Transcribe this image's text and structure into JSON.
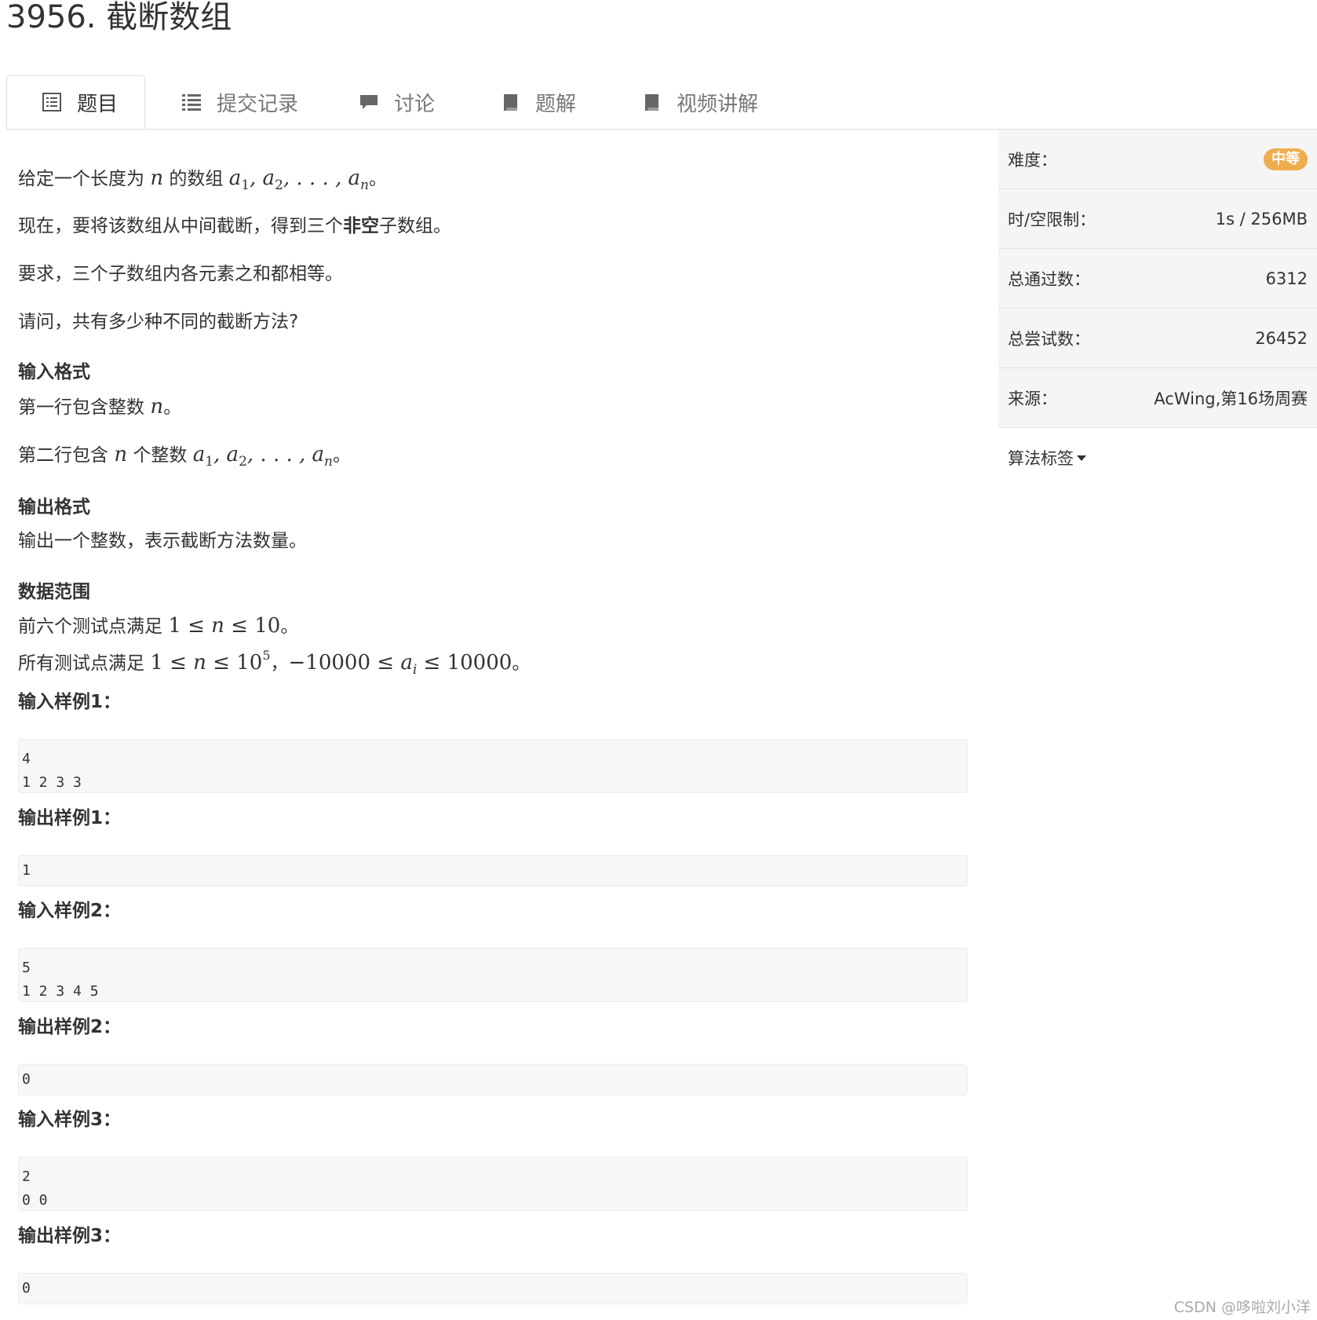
{
  "title": "3956. 截断数组",
  "tabs": [
    {
      "label": "题目",
      "icon": "list-alt-icon"
    },
    {
      "label": "提交记录",
      "icon": "list-icon"
    },
    {
      "label": "讨论",
      "icon": "comment-icon"
    },
    {
      "label": "题解",
      "icon": "book-icon"
    },
    {
      "label": "视频讲解",
      "icon": "book-icon"
    }
  ],
  "problem": {
    "p1": {
      "a": "给定一个长度为 ",
      "n": "n",
      "b": " 的数组 ",
      "c": "。"
    },
    "p2": {
      "a": "现在，要将该数组从中间截断，得到三个",
      "bold": "非空",
      "b": "子数组。"
    },
    "p3": "要求，三个子数组内各元素之和都相等。",
    "p4": "请问，共有多少种不同的截断方法?",
    "input_heading": "输入格式",
    "input_line1": {
      "a": "第一行包含整数 ",
      "b": "。"
    },
    "input_line2": {
      "a": "第二行包含 ",
      "b": " 个整数 ",
      "c": "。"
    },
    "output_heading": "输出格式",
    "output_line": "输出一个整数，表示截断方法数量。",
    "range_heading": "数据范围",
    "range_line1": {
      "a": "前六个测试点满足 ",
      "b": "。"
    },
    "range_line2": {
      "a": "所有测试点满足 ",
      "b": "，",
      "c": "。"
    }
  },
  "samples": [
    {
      "label": "输入样例1：",
      "content": "4\n1 2 3 3"
    },
    {
      "label": "输出样例1：",
      "content": "1"
    },
    {
      "label": "输入样例2：",
      "content": "5\n1 2 3 4 5"
    },
    {
      "label": "输出样例2：",
      "content": "0"
    },
    {
      "label": "输入样例3：",
      "content": "2\n0 0"
    },
    {
      "label": "输出样例3：",
      "content": "0"
    }
  ],
  "sidebar": {
    "difficulty_label": "难度：",
    "difficulty_value": "中等",
    "limit_label": "时/空限制：",
    "limit_value": "1s / 256MB",
    "passed_label": "总通过数：",
    "passed_value": "6312",
    "attempts_label": "总尝试数：",
    "attempts_value": "26452",
    "source_label": "来源：",
    "source_value": "AcWing,第16场周赛",
    "tags_label": "算法标签"
  },
  "watermark": "CSDN @哆啦刘小洋",
  "colors": {
    "badge": "#f0ad4e",
    "code_bg": "#f7f7f9",
    "sidebar_bg": "#f5f5f5"
  }
}
